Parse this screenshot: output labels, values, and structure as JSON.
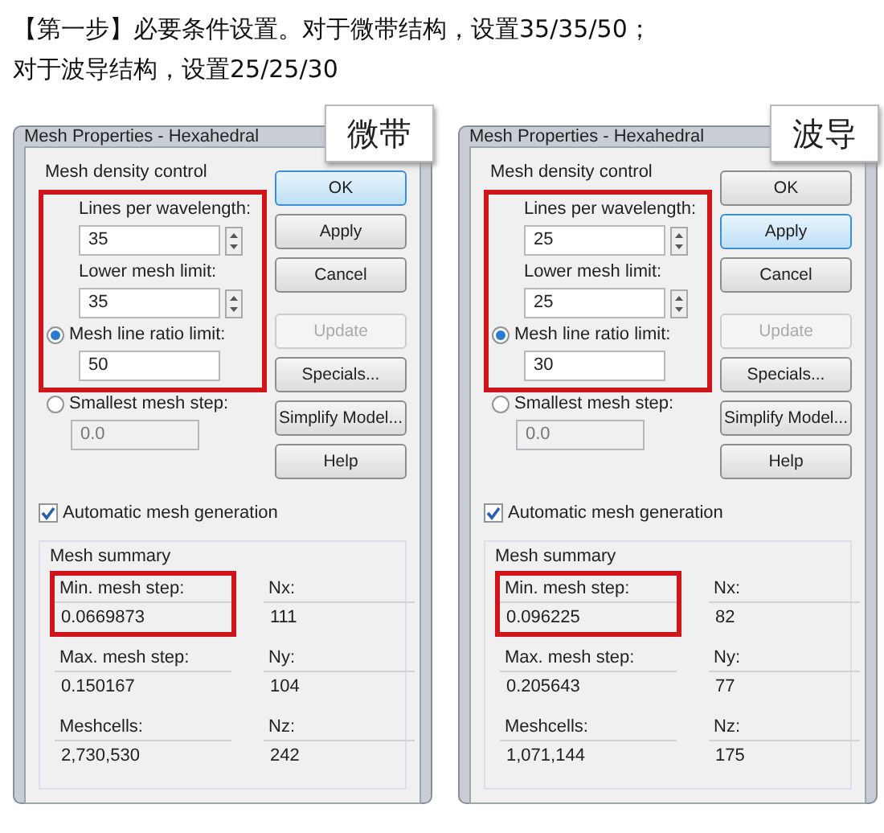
{
  "heading": [
    "【第一步】必要条件设置。对于微带结构，设置35/35/50；",
    "对于波导结构，设置25/25/30"
  ],
  "dialogs": [
    {
      "title": "Mesh Properties - Hexahedral",
      "tag": "微带",
      "density": {
        "label": "Mesh density control",
        "highlighted": true,
        "fields": [
          {
            "label": "Lines per wavelength:",
            "value": "35"
          },
          {
            "label": "Lower mesh limit:",
            "value": "35"
          }
        ],
        "ratio": {
          "label": "Mesh line ratio limit:",
          "value": "50",
          "selected": true
        },
        "smallest": {
          "label": "Smallest mesh step:",
          "value": "0.0",
          "selected": false
        }
      },
      "buttons": [
        {
          "label": "OK",
          "focused": true,
          "disabled": false
        },
        {
          "label": "Apply",
          "focused": false,
          "disabled": false
        },
        {
          "label": "Cancel",
          "focused": false,
          "disabled": false
        },
        {
          "label": "Update",
          "focused": false,
          "disabled": true
        },
        {
          "label": "Specials...",
          "focused": false,
          "disabled": false
        },
        {
          "label": "Simplify Model...",
          "focused": false,
          "disabled": false
        },
        {
          "label": "Help",
          "focused": false,
          "disabled": false
        }
      ],
      "auto": {
        "label": "Automatic mesh generation",
        "checked": true
      },
      "summary": {
        "label": "Mesh summary",
        "cells": [
          {
            "label": "Min. mesh step:",
            "value": "0.0669873",
            "highlighted": true
          },
          {
            "label": "Nx:",
            "value": "111",
            "highlighted": false
          },
          {
            "label": "Max. mesh step:",
            "value": "0.150167",
            "highlighted": false
          },
          {
            "label": "Ny:",
            "value": "104",
            "highlighted": false
          },
          {
            "label": "Meshcells:",
            "value": "2,730,530",
            "highlighted": false
          },
          {
            "label": "Nz:",
            "value": "242",
            "highlighted": false
          }
        ]
      }
    },
    {
      "title": "Mesh Properties - Hexahedral",
      "tag": "波导",
      "density": {
        "label": "Mesh density control",
        "highlighted": true,
        "fields": [
          {
            "label": "Lines per wavelength:",
            "value": "25"
          },
          {
            "label": "Lower mesh limit:",
            "value": "25"
          }
        ],
        "ratio": {
          "label": "Mesh line ratio limit:",
          "value": "30",
          "selected": true
        },
        "smallest": {
          "label": "Smallest mesh step:",
          "value": "0.0",
          "selected": false
        }
      },
      "buttons": [
        {
          "label": "OK",
          "focused": false,
          "disabled": false
        },
        {
          "label": "Apply",
          "focused": true,
          "disabled": false
        },
        {
          "label": "Cancel",
          "focused": false,
          "disabled": false
        },
        {
          "label": "Update",
          "focused": false,
          "disabled": true
        },
        {
          "label": "Specials...",
          "focused": false,
          "disabled": false
        },
        {
          "label": "Simplify Model...",
          "focused": false,
          "disabled": false
        },
        {
          "label": "Help",
          "focused": false,
          "disabled": false
        }
      ],
      "auto": {
        "label": "Automatic mesh generation",
        "checked": true
      },
      "summary": {
        "label": "Mesh summary",
        "cells": [
          {
            "label": "Min. mesh step:",
            "value": "0.096225",
            "highlighted": true
          },
          {
            "label": "Nx:",
            "value": "82",
            "highlighted": false
          },
          {
            "label": "Max. mesh step:",
            "value": "0.205643",
            "highlighted": false
          },
          {
            "label": "Ny:",
            "value": "77",
            "highlighted": false
          },
          {
            "label": "Meshcells:",
            "value": "1,071,144",
            "highlighted": false
          },
          {
            "label": "Nz:",
            "value": "175",
            "highlighted": false
          }
        ]
      }
    }
  ]
}
